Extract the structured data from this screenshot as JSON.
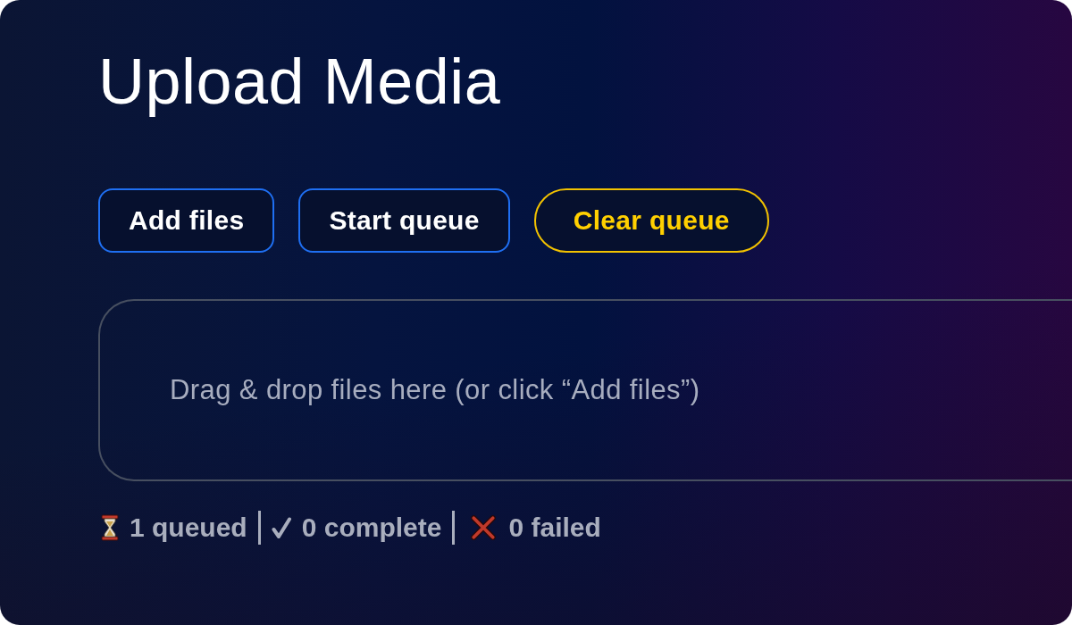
{
  "title": "Upload Media",
  "actions": [
    {
      "label": "Add files",
      "kind": "primary"
    },
    {
      "label": "Start queue",
      "kind": "primary"
    },
    {
      "label": "Clear queue",
      "kind": "warning"
    }
  ],
  "drop_zone": {
    "text": "Drag & drop files here (or click “Add files”)"
  },
  "status": [
    {
      "kind": "queued",
      "text": "1 queued"
    },
    {
      "kind": "complete",
      "text": "0 complete"
    },
    {
      "kind": "failed",
      "text": "0 failed"
    }
  ]
}
